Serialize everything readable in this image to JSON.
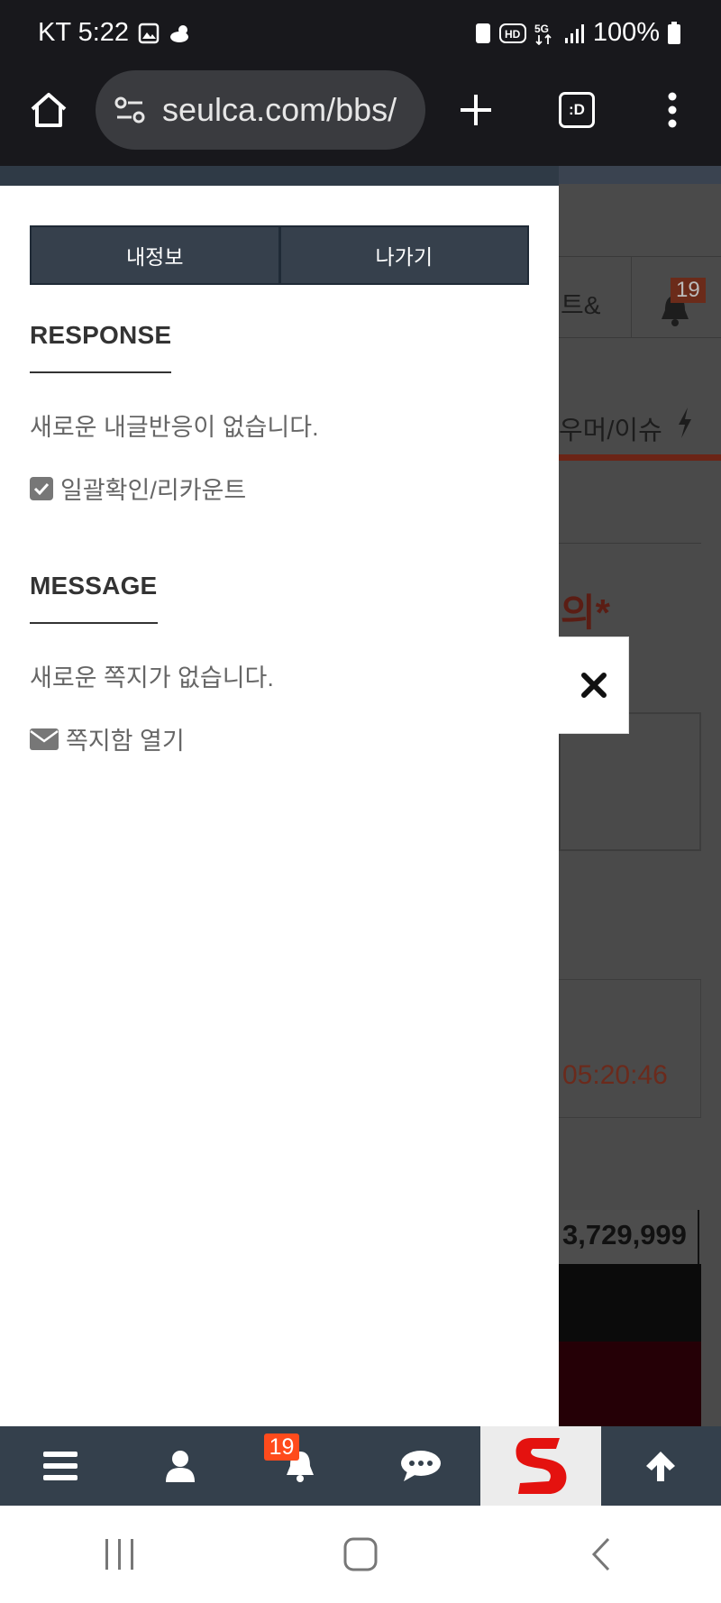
{
  "status_bar": {
    "carrier_time": "KT 5:22",
    "battery": "100%"
  },
  "browser": {
    "url": "seulca.com/bbs/",
    "tab_count_label": ":D"
  },
  "drawer": {
    "tabs": [
      "내정보",
      "나가기"
    ],
    "response": {
      "title": "RESPONSE",
      "empty_text": "새로운 내글반응이 없습니다.",
      "link_label": "일괄확인/리카운트"
    },
    "message": {
      "title": "MESSAGE",
      "empty_text": "새로운 쪽지가 없습니다.",
      "link_label": "쪽지함 열기"
    }
  },
  "background_page": {
    "nav_partial": "트&",
    "bell_badge": "19",
    "menu_partial": "우머/이슈",
    "title_partial": "의*",
    "time": "05:20:46",
    "number": "3,729,999"
  },
  "bottom_nav": {
    "notification_badge": "19"
  },
  "colors": {
    "drawer_tab_bg": "#36404c",
    "badge": "#ff4b1c",
    "accent_red": "#c0392b"
  }
}
